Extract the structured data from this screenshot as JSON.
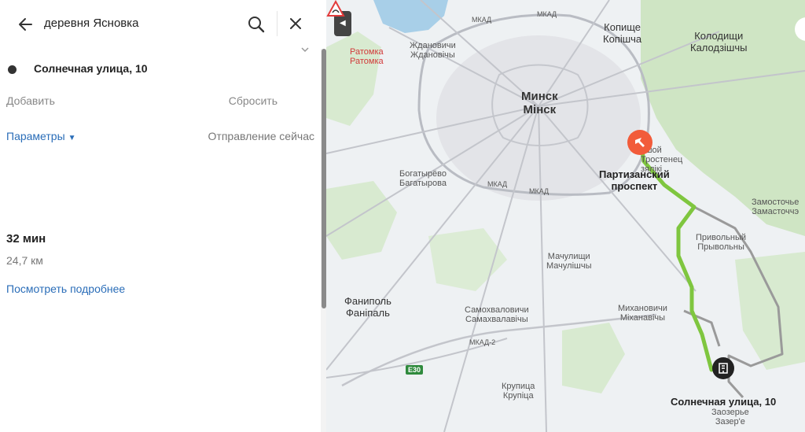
{
  "search": {
    "query": "деревня Ясновка",
    "search_icon": "search-icon",
    "close_icon": "close-icon",
    "back_icon": "arrow-left-icon"
  },
  "route_point": {
    "label": "Солнечная улица, 10"
  },
  "actions": {
    "add": "Добавить",
    "reset": "Сбросить"
  },
  "params": {
    "label": "Параметры",
    "departure": "Отправление сейчас"
  },
  "summary": {
    "duration": "32 мин",
    "distance": "24,7 км",
    "details_link": "Посмотреть подробнее"
  },
  "map": {
    "city": {
      "ru": "Минск",
      "by": "Мінск"
    },
    "labels": {
      "ratomka_ru": "Ратомка",
      "ratomka_by": "Ратомка",
      "zhdanovichi_ru": "Ждановичи",
      "zhdanovichi_by": "Ждановічы",
      "kopishche_ru": "Копище",
      "kopishche_by": "Копішча",
      "kolodishchi_ru": "Колодищи",
      "kolodishchi_by": "Калодзішчы",
      "bolshoy_trostenets_1": "ьшой",
      "bolshoy_trostenets_2": "Тростенец",
      "bolshoy_trostenets_3": "зялікі",
      "bogatyrevo_ru": "Богатырёво",
      "bogatyrevo_by": "Багатырова",
      "zamostochye_ru": "Замосточье",
      "zamostochye_by": "Замасточчэ",
      "privolny_ru": "Привольный",
      "privolny_by": "Прывольны",
      "machulishchi_ru": "Мачулищи",
      "machulishchi_by": "Мачулішчы",
      "fanipol_ru": "Фаниполь",
      "fanipol_by": "Фаніпаль",
      "samokhvalovichi_ru": "Самохваловичи",
      "samokhvalovichi_by": "Самахвалавічы",
      "mikhanovichi_ru": "Михановичи",
      "mikhanovichi_by": "Міханавічы",
      "krupitsa_ru": "Крупица",
      "krupitsa_by": "Крупіца",
      "zazerye_ru": "Заозерье",
      "zazerye_by": "Зазер'е"
    },
    "route_labels": {
      "start_1": "Партизанский",
      "start_2": "проспект",
      "end": "Солнечная улица, 10"
    },
    "mkad": "МКАД",
    "mkad2": "МКАД-2",
    "e30": "E30",
    "colors": {
      "route": "#7fc63f",
      "alt_route": "#9a9a9a",
      "start": "#f25b3a",
      "end": "#222222",
      "forest": "#cfe5c4",
      "water": "#a8cfe8"
    }
  }
}
